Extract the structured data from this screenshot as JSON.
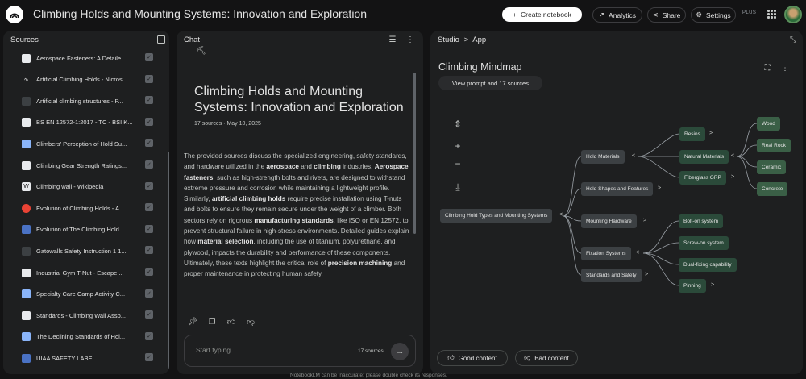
{
  "app": {
    "title": "Climbing Holds and Mounting Systems: Innovation and Exploration",
    "create_label": "Create notebook",
    "analytics_label": "Analytics",
    "share_label": "Share",
    "settings_label": "Settings",
    "plan_label": "PLUS"
  },
  "sources": {
    "title": "Sources",
    "items": [
      {
        "label": "Aerospace Fasteners: A Detaile...",
        "icon": "doc-icon"
      },
      {
        "label": "Artificial Climbing Holds - Nicros",
        "icon": "chart-icon"
      },
      {
        "label": "Artificial climbing structures - P...",
        "icon": "dark-icon"
      },
      {
        "label": "BS EN 12572-1:2017 - TC - BSI K...",
        "icon": "doc-icon"
      },
      {
        "label": "Climbers' Perception of Hold Su...",
        "icon": "color-icon"
      },
      {
        "label": "Climbing Gear Strength Ratings...",
        "icon": "doc-icon"
      },
      {
        "label": "Climbing wall - Wikipedia",
        "icon": "wiki-icon"
      },
      {
        "label": "Evolution of Climbing Holds - A ...",
        "icon": "red-icon"
      },
      {
        "label": "Evolution of The Climbing Hold",
        "icon": "blue-icon"
      },
      {
        "label": "Gatowalls Safety Instruction 1 1...",
        "icon": "dark-icon"
      },
      {
        "label": "Industrial Gym T-Nut - Escape ...",
        "icon": "doc-icon"
      },
      {
        "label": "Specialty Care Camp Activity C...",
        "icon": "color-icon"
      },
      {
        "label": "Standards - Climbing Wall Asso...",
        "icon": "doc-icon"
      },
      {
        "label": "The Declining Standards of Hol...",
        "icon": "color-icon"
      },
      {
        "label": "UIAA SAFETY LABEL",
        "icon": "blue-icon"
      }
    ]
  },
  "chat": {
    "title": "Chat",
    "note_title": "Climbing Holds and Mounting Systems: Innovation and Exploration",
    "meta": "17 sources · May 10, 2025",
    "summary_parts": [
      "The provided sources discuss the specialized engineering, safety standards, and hardware utilized in the ",
      "aerospace",
      " and ",
      "climbing",
      " industries. ",
      "Aerospace fasteners",
      ", such as high-strength bolts and rivets, are designed to withstand extreme pressure and corrosion while maintaining a lightweight profile. Similarly, ",
      "artificial climbing holds",
      " require precise installation using T-nuts and bolts to ensure they remain secure under the weight of a climber. Both sectors rely on rigorous ",
      "manufacturing standards",
      ", like ISO or EN 12572, to prevent structural failure in high-stress environments. Detailed guides explain how ",
      "material selection",
      ", including the use of titanium, polyurethane, and plywood, impacts the durability and performance of these components. Ultimately, these texts highlight the critical role of ",
      "precision machining",
      " and proper maintenance in protecting human safety."
    ],
    "input_placeholder": "Start typing...",
    "source_count": "17 sources"
  },
  "studio": {
    "title": "Studio",
    "breadcrumb": "App",
    "mindmap_title": "Climbing Mindmap",
    "prompt_label": "View prompt and 17 sources",
    "root": "Climbing Hold Types and Mounting Systems",
    "level1": [
      "Hold Materials",
      "Hold Shapes and Features",
      "Mounting Hardware",
      "Fixation Systems",
      "Standards and Safety"
    ],
    "materials": [
      "Resins",
      "Natural Materials",
      "Fiberglass GRP"
    ],
    "natural": [
      "Wood",
      "Real Rock",
      "Ceramic",
      "Concrete"
    ],
    "fixation": [
      "Bolt-on system",
      "Screw-on system",
      "Dual-fixing capability",
      "Pinning"
    ],
    "good_label": "Good content",
    "bad_label": "Bad content"
  },
  "footer": {
    "note": "NotebookLM can be inaccurate; please double check its responses."
  },
  "colors": {
    "background": "#131314",
    "panel": "#1e1f20",
    "node_blue": "#3c4043",
    "node_green": "#2b4a3a"
  }
}
